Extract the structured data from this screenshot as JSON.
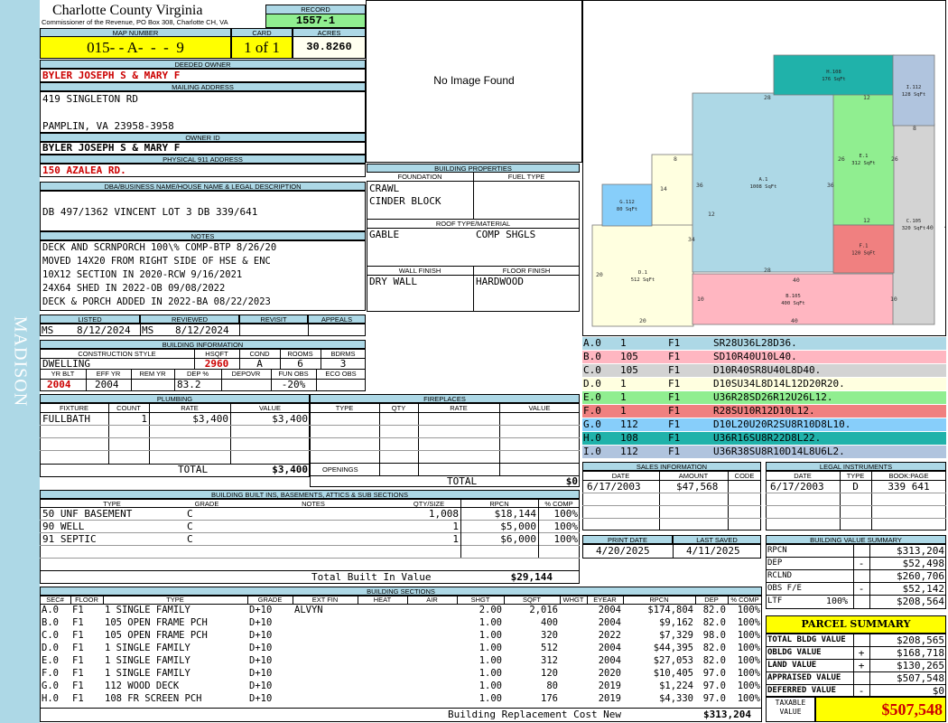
{
  "side_label": "MADISON",
  "county": {
    "name": "Charlotte County Virginia",
    "office": "Commissioner of the Revenue, PO Box 308, Charlotte CH, VA"
  },
  "record": {
    "label": "RECORD",
    "value": "1557-1"
  },
  "map_number": {
    "label": "MAP NUMBER",
    "value": "015- - A-  -  -  9"
  },
  "card": {
    "label": "CARD",
    "value": "1 of 1"
  },
  "acres": {
    "label": "ACRES",
    "value": "30.8260"
  },
  "deeded_owner": {
    "label": "DEEDED OWNER",
    "value": "BYLER JOSEPH S & MARY F"
  },
  "mailing_address": {
    "label": "MAILING ADDRESS",
    "line1": "419 SINGLETON RD",
    "line2": "PAMPLIN, VA 23958-3958"
  },
  "owner_id": {
    "label": "OWNER ID",
    "value": "BYLER JOSEPH S & MARY F"
  },
  "physical_address": {
    "label": "PHYSICAL 911 ADDRESS",
    "value": "150 AZALEA RD."
  },
  "dba": {
    "label": "DBA/BUSINESS NAME/HOUSE NAME & LEGAL DESCRIPTION",
    "value": "DB 497/1362 VINCENT LOT 3  DB 339/641"
  },
  "notes": {
    "label": "NOTES",
    "lines": [
      "DECK AND SCRNPORCH 100\\% COMP-BTP 8/26/20",
      "MOVED 14X20 FROM RIGHT SIDE OF HSE & ENC",
      "10X12 SECTION IN 2020-RCW 9/16/2021",
      "24X64 SHED IN 2022-OB 09/08/2022",
      "DECK & PORCH ADDED IN 2022-BA 08/22/2023"
    ]
  },
  "listed": {
    "label": "LISTED",
    "initials": "MS",
    "date": "8/12/2024"
  },
  "reviewed": {
    "label": "REVIEWED",
    "initials": "MS",
    "date": "8/12/2024"
  },
  "revisit": {
    "label": "REVISIT"
  },
  "appeals": {
    "label": "APPEALS"
  },
  "building_info": {
    "label": "BUILDING INFORMATION",
    "construction_style_label": "CONSTRUCTION STYLE",
    "construction_style": "DWELLING",
    "hsqft_label": "HSQFT",
    "hsqft": "2960",
    "cond_label": "COND",
    "cond": "A",
    "rooms_label": "ROOMS",
    "rooms": "6",
    "bdrms_label": "BDRMS",
    "bdrms": "3",
    "yr_blt_label": "YR BLT",
    "yr_blt": "2004",
    "eff_yr_label": "EFF YR",
    "eff_yr": "2004",
    "rem_yr_label": "REM YR",
    "rem_yr": "",
    "dep_pct_label": "DEP %",
    "dep_pct": "83.2",
    "depovr_label": "DEPOVR",
    "depovr": "",
    "fun_obs_label": "FUN OBS",
    "fun_obs": "-20%",
    "eco_obs_label": "ECO OBS",
    "eco_obs": ""
  },
  "plumbing": {
    "label": "PLUMBING",
    "headers": [
      "FIXTURE",
      "COUNT",
      "RATE",
      "VALUE"
    ],
    "rows": [
      {
        "fixture": "FULLBATH",
        "count": "1",
        "rate": "$3,400",
        "value": "$3,400"
      }
    ],
    "total_label": "TOTAL",
    "total": "$3,400"
  },
  "fireplaces": {
    "label": "FIREPLACES",
    "headers": [
      "TYPE",
      "QTY",
      "RATE",
      "VALUE"
    ],
    "openings_label": "OPENINGS",
    "total_label": "TOTAL",
    "total": "$0"
  },
  "photo": {
    "text": "No Image Found"
  },
  "building_properties": {
    "label": "BUILDING PROPERTIES",
    "foundation_label": "FOUNDATION",
    "foundation": [
      "CRAWL",
      "CINDER BLOCK"
    ],
    "fuel_type_label": "FUEL TYPE",
    "fuel_type": "",
    "roof_label": "ROOF TYPE/MATERIAL",
    "roof_type": "GABLE",
    "roof_material": "COMP SHGLS",
    "wall_finish_label": "WALL FINISH",
    "wall_finish": "DRY WALL",
    "floor_finish_label": "FLOOR FINISH",
    "floor_finish": "HARDWOOD"
  },
  "sketch": {
    "areas": [
      {
        "id": "A.1",
        "sqft": "1008 SqFt",
        "color": "#add8e6"
      },
      {
        "id": "B.105",
        "sqft": "400 SqFt",
        "color": "#ffb6c1"
      },
      {
        "id": "C.105",
        "sqft": "320 SqFt",
        "color": "#d3d3d3"
      },
      {
        "id": "D.1",
        "sqft": "512 SqFt",
        "color": "#ffffe0"
      },
      {
        "id": "E.1",
        "sqft": "312 SqFt",
        "color": "#90ee90"
      },
      {
        "id": "F.1",
        "sqft": "120 SqFt",
        "color": "#f08080"
      },
      {
        "id": "G.112",
        "sqft": "80 SqFt",
        "color": "#87cefa"
      },
      {
        "id": "H.108",
        "sqft": "176 SqFt",
        "color": "#20b2aa"
      },
      {
        "id": "I.112",
        "sqft": "128 SqFt",
        "color": "#b0c4de"
      }
    ],
    "dimensions": [
      "28",
      "12",
      "8",
      "14",
      "36",
      "36",
      "26",
      "26",
      "12",
      "34",
      "12",
      "20",
      "28",
      "40",
      "40",
      "40",
      "10",
      "10",
      "20",
      "40",
      "8"
    ]
  },
  "sketch_legend": [
    {
      "code": "A.0",
      "n": "1",
      "fl": "F1",
      "path": "SR28U36L28D36.",
      "color": "#add8e6"
    },
    {
      "code": "B.0",
      "n": "105",
      "fl": "F1",
      "path": "SD10R40U10L40.",
      "color": "#ffb6c1"
    },
    {
      "code": "C.0",
      "n": "105",
      "fl": "F1",
      "path": "D10R40SR8U40L8D40.",
      "color": "#d3d3d3"
    },
    {
      "code": "D.0",
      "n": "1",
      "fl": "F1",
      "path": "D10SU34L8D14L12D20R20.",
      "color": "#ffffe0"
    },
    {
      "code": "E.0",
      "n": "1",
      "fl": "F1",
      "path": "U36R28SD26R12U26L12.",
      "color": "#90ee90"
    },
    {
      "code": "F.0",
      "n": "1",
      "fl": "F1",
      "path": "R28SU10R12D10L12.",
      "color": "#f08080"
    },
    {
      "code": "G.0",
      "n": "112",
      "fl": "F1",
      "path": "D10L20U20R2SU8R10D8L10.",
      "color": "#87cefa"
    },
    {
      "code": "H.0",
      "n": "108",
      "fl": "F1",
      "path": "U36R16SU8R22D8L22.",
      "color": "#20b2aa"
    },
    {
      "code": "I.0",
      "n": "112",
      "fl": "F1",
      "path": "U36R38SU8R10D14L8U6L2.",
      "color": "#b0c4de"
    }
  ],
  "sales": {
    "label": "SALES INFORMATION",
    "headers": [
      "DATE",
      "AMOUNT",
      "CODE"
    ],
    "rows": [
      {
        "date": "6/17/2003",
        "amount": "$47,568",
        "code": ""
      }
    ]
  },
  "legal": {
    "label": "LEGAL INSTRUMENTS",
    "headers": [
      "DATE",
      "TYPE",
      "BOOK:PAGE"
    ],
    "rows": [
      {
        "date": "6/17/2003",
        "type": "D",
        "bookpage": "339 641"
      }
    ]
  },
  "print_date": {
    "label": "PRINT DATE",
    "value": "4/20/2025"
  },
  "last_saved": {
    "label": "LAST SAVED",
    "value": "4/11/2025"
  },
  "value_summary": {
    "label": "BUILDING VALUE SUMMARY",
    "rows": [
      {
        "label": "RPCN",
        "sign": "",
        "value": "$313,204"
      },
      {
        "label": "DEP",
        "sign": "-",
        "value": "$52,498"
      },
      {
        "label": "RCLND",
        "sign": "",
        "value": "$260,706"
      },
      {
        "label": "OBS F/E",
        "sign": "-",
        "value": "$52,142"
      },
      {
        "label": "LTF",
        "pct": "100%",
        "sign": "",
        "value": "$208,564"
      }
    ]
  },
  "parcel_summary": {
    "label": "PARCEL SUMMARY",
    "rows": [
      {
        "label": "TOTAL BLDG VALUE",
        "sign": "",
        "value": "$208,565"
      },
      {
        "label": "OBLDG VALUE",
        "sign": "+",
        "value": "$168,718"
      },
      {
        "label": "LAND VALUE",
        "sign": "+",
        "value": "$130,265"
      },
      {
        "label": "APPRAISED VALUE",
        "sign": "",
        "value": "$507,548"
      },
      {
        "label": "DEFERRED VALUE",
        "sign": "-",
        "value": "$0"
      }
    ],
    "taxable_label_1": "TAXABLE",
    "taxable_label_2": "VALUE",
    "taxable_value": "$507,548"
  },
  "built_ins": {
    "label": "BUILDING BUILT INS, BASEMENTS, ATTICS & SUB SECTIONS",
    "headers": [
      "TYPE",
      "GRADE",
      "NOTES",
      "QTY/SIZE",
      "RPCN",
      "% COMP"
    ],
    "rows": [
      {
        "type": "50 UNF BASEMENT",
        "grade": "C",
        "notes": "",
        "qty": "1,008",
        "rpcn": "$18,144",
        "comp": "100%"
      },
      {
        "type": "90 WELL",
        "grade": "C",
        "notes": "",
        "qty": "1",
        "rpcn": "$5,000",
        "comp": "100%"
      },
      {
        "type": "91 SEPTIC",
        "grade": "C",
        "notes": "",
        "qty": "1",
        "rpcn": "$6,000",
        "comp": "100%"
      }
    ],
    "total_label": "Total Built In Value",
    "total": "$29,144"
  },
  "building_sections": {
    "label": "BUILDING SECTIONS",
    "headers": [
      "SEC#",
      "FLOOR",
      "TYPE",
      "GRADE",
      "EXT FIN",
      "HEAT",
      "AIR",
      "SHGT",
      "SQFT",
      "WHGT",
      "EYEAR",
      "RPCN",
      "DEP",
      "% COMP"
    ],
    "rows": [
      {
        "sec": "A.0",
        "floor": "F1",
        "type": "1 SINGLE FAMILY",
        "grade": "D+10",
        "ext": "ALVYN",
        "heat": "",
        "air": "",
        "shgt": "2.00",
        "sqft": "2,016",
        "whgt": "",
        "eyear": "2004",
        "rpcn": "$174,804",
        "dep": "82.0",
        "comp": "100%"
      },
      {
        "sec": "B.0",
        "floor": "F1",
        "type": "105 OPEN FRAME PCH",
        "grade": "D+10",
        "ext": "",
        "heat": "",
        "air": "",
        "shgt": "1.00",
        "sqft": "400",
        "whgt": "",
        "eyear": "2004",
        "rpcn": "$9,162",
        "dep": "82.0",
        "comp": "100%"
      },
      {
        "sec": "C.0",
        "floor": "F1",
        "type": "105 OPEN FRAME PCH",
        "grade": "D+10",
        "ext": "",
        "heat": "",
        "air": "",
        "shgt": "1.00",
        "sqft": "320",
        "whgt": "",
        "eyear": "2022",
        "rpcn": "$7,329",
        "dep": "98.0",
        "comp": "100%"
      },
      {
        "sec": "D.0",
        "floor": "F1",
        "type": "1 SINGLE FAMILY",
        "grade": "D+10",
        "ext": "",
        "heat": "",
        "air": "",
        "shgt": "1.00",
        "sqft": "512",
        "whgt": "",
        "eyear": "2004",
        "rpcn": "$44,395",
        "dep": "82.0",
        "comp": "100%"
      },
      {
        "sec": "E.0",
        "floor": "F1",
        "type": "1 SINGLE FAMILY",
        "grade": "D+10",
        "ext": "",
        "heat": "",
        "air": "",
        "shgt": "1.00",
        "sqft": "312",
        "whgt": "",
        "eyear": "2004",
        "rpcn": "$27,053",
        "dep": "82.0",
        "comp": "100%"
      },
      {
        "sec": "F.0",
        "floor": "F1",
        "type": "1 SINGLE FAMILY",
        "grade": "D+10",
        "ext": "",
        "heat": "",
        "air": "",
        "shgt": "1.00",
        "sqft": "120",
        "whgt": "",
        "eyear": "2020",
        "rpcn": "$10,405",
        "dep": "97.0",
        "comp": "100%"
      },
      {
        "sec": "G.0",
        "floor": "F1",
        "type": "112 WOOD DECK",
        "grade": "D+10",
        "ext": "",
        "heat": "",
        "air": "",
        "shgt": "1.00",
        "sqft": "80",
        "whgt": "",
        "eyear": "2019",
        "rpcn": "$1,224",
        "dep": "97.0",
        "comp": "100%"
      },
      {
        "sec": "H.0",
        "floor": "F1",
        "type": "108 FR SCREEN PCH",
        "grade": "D+10",
        "ext": "",
        "heat": "",
        "air": "",
        "shgt": "1.00",
        "sqft": "176",
        "whgt": "",
        "eyear": "2019",
        "rpcn": "$4,330",
        "dep": "97.0",
        "comp": "100%"
      }
    ],
    "total_label": "Building Replacement Cost New",
    "total": "$313,204"
  }
}
